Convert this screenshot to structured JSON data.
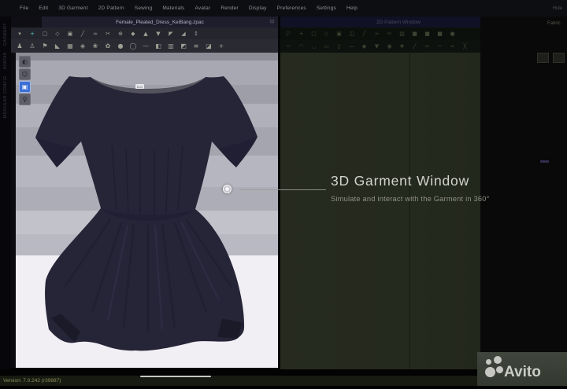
{
  "menubar": {
    "items": [
      {
        "name": "menu-file",
        "label": "File"
      },
      {
        "name": "menu-edit",
        "label": "Edit"
      },
      {
        "name": "menu-3d-garment",
        "label": "3D Garment"
      },
      {
        "name": "menu-2d-pattern",
        "label": "2D Pattern"
      },
      {
        "name": "menu-sewing",
        "label": "Sewing"
      },
      {
        "name": "menu-materials",
        "label": "Materials"
      },
      {
        "name": "menu-avatar",
        "label": "Avatar"
      },
      {
        "name": "menu-render",
        "label": "Render"
      },
      {
        "name": "menu-display",
        "label": "Display"
      },
      {
        "name": "menu-preferences",
        "label": "Preferences"
      },
      {
        "name": "menu-settings",
        "label": "Settings"
      },
      {
        "name": "menu-help",
        "label": "Help"
      }
    ],
    "right_label": "Hide"
  },
  "left_tabs": [
    "GARMENT",
    "AVATAR",
    "MODULAR CONFIG"
  ],
  "garment_window": {
    "title": "Female_Pleated_Dress_KeiBang.zpac",
    "popout_glyph": "⊡",
    "toolbar_row1": [
      {
        "name": "select-tool-icon",
        "glyph": "▾"
      },
      {
        "name": "add-point-icon",
        "glyph": "+"
      },
      {
        "name": "rectangle-tool-icon",
        "glyph": "▢"
      },
      {
        "name": "polygon-tool-icon",
        "glyph": "◇"
      },
      {
        "name": "paste-pattern-icon",
        "glyph": "▣"
      },
      {
        "name": "segment-sewing-icon",
        "glyph": "╱"
      },
      {
        "name": "free-sewing-icon",
        "glyph": "≈"
      },
      {
        "name": "edit-sewing-icon",
        "glyph": "✂"
      },
      {
        "name": "pin-tool-icon",
        "glyph": "⊕"
      },
      {
        "name": "fold-arrangement-icon",
        "glyph": "◆"
      },
      {
        "name": "arrange-front-icon",
        "glyph": "▲"
      },
      {
        "name": "arrange-back-icon",
        "glyph": "▼"
      },
      {
        "name": "flip-left-icon",
        "glyph": "◤"
      },
      {
        "name": "flip-right-icon",
        "glyph": "◢"
      },
      {
        "name": "move-garment-icon",
        "glyph": "↕"
      }
    ],
    "toolbar_row2": [
      {
        "name": "simulate-icon",
        "glyph": "♟"
      },
      {
        "name": "avatar-pose-icon",
        "glyph": "♙"
      },
      {
        "name": "avatar-tape-icon",
        "glyph": "⚑"
      },
      {
        "name": "avatar-measure-icon",
        "glyph": "◣"
      },
      {
        "name": "garment-fit-icon",
        "glyph": "▦"
      },
      {
        "name": "pressure-map-icon",
        "glyph": "◈"
      },
      {
        "name": "flower-trim-icon",
        "glyph": "❀"
      },
      {
        "name": "button-trim-icon",
        "glyph": "✿"
      },
      {
        "name": "buttonhole-icon",
        "glyph": "●"
      },
      {
        "name": "grading-icon",
        "glyph": "◯"
      },
      {
        "name": "seam-line-icon",
        "glyph": "—"
      },
      {
        "name": "texture-icon",
        "glyph": "◧"
      },
      {
        "name": "uv-map-icon",
        "glyph": "▥"
      },
      {
        "name": "layer-icon",
        "glyph": "◩"
      },
      {
        "name": "stack-icon",
        "glyph": "≡"
      },
      {
        "name": "mirror-icon",
        "glyph": "◪"
      },
      {
        "name": "zoom-tool-icon",
        "glyph": "+"
      }
    ],
    "side_tools": [
      {
        "name": "show-avatar-button",
        "glyph": "◐"
      },
      {
        "name": "show-skin-button",
        "glyph": "☺"
      },
      {
        "name": "show-garment-button",
        "glyph": "▣",
        "active": true
      },
      {
        "name": "show-mannequin-button",
        "glyph": "♀"
      }
    ],
    "label_tag": "CLO"
  },
  "pattern_window": {
    "title": "2D Pattern Window",
    "titlebar_icons": [
      {
        "name": "pattern-popout-icon",
        "glyph": "⊡"
      },
      {
        "name": "pattern-collapse-icon",
        "glyph": "⌄"
      }
    ],
    "toolbar_row1": [
      {
        "name": "transform-pattern-icon",
        "glyph": "◸"
      },
      {
        "name": "edit-pattern-icon",
        "glyph": "+"
      },
      {
        "name": "add-rectangle-icon",
        "glyph": "▢"
      },
      {
        "name": "add-polygon-icon",
        "glyph": "◇"
      },
      {
        "name": "dart-icon",
        "glyph": "▣"
      },
      {
        "name": "trace-icon",
        "glyph": "◫"
      },
      {
        "name": "sewing-2d-icon",
        "glyph": "╱"
      },
      {
        "name": "free-sewing-2d-icon",
        "glyph": "≈"
      },
      {
        "name": "scissors-icon",
        "glyph": "✂"
      },
      {
        "name": "hatch-icon",
        "glyph": "▨"
      },
      {
        "name": "swatch-1-icon",
        "glyph": "■"
      },
      {
        "name": "swatch-2-icon",
        "glyph": "■"
      },
      {
        "name": "swatch-3-icon",
        "glyph": "■"
      },
      {
        "name": "point-icon",
        "glyph": "●"
      }
    ],
    "toolbar_row2": [
      {
        "name": "unfold-icon",
        "glyph": "⌐"
      },
      {
        "name": "curve-up-icon",
        "glyph": "◠"
      },
      {
        "name": "curve-down-icon",
        "glyph": "◡"
      },
      {
        "name": "seam-allowance-icon",
        "glyph": "▭"
      },
      {
        "name": "notch-icon",
        "glyph": "▯"
      },
      {
        "name": "baseline-icon",
        "glyph": "—"
      },
      {
        "name": "grain-line-icon",
        "glyph": "◆"
      },
      {
        "name": "pleat-icon",
        "glyph": "▼"
      },
      {
        "name": "circle-pattern-icon",
        "glyph": "◉"
      },
      {
        "name": "symmetry-icon",
        "glyph": "❖"
      },
      {
        "name": "slash-icon",
        "glyph": "╱"
      },
      {
        "name": "parallel-icon",
        "glyph": "═"
      },
      {
        "name": "wave-icon",
        "glyph": "~"
      },
      {
        "name": "approx-icon",
        "glyph": "≃"
      },
      {
        "name": "cross-icon",
        "glyph": "╳"
      }
    ],
    "fabric_label": "Fabric"
  },
  "overlay": {
    "title": "3D Garment Window",
    "subtitle": "Simulate and interact with the Garment in 360°"
  },
  "statusbar": {
    "version_text": "Version: 7.0.242 (r39887)"
  },
  "watermark": {
    "brand": "Avito"
  },
  "colors": {
    "accent_blue": "#3d6fd6",
    "garment": "#262538",
    "garment_shadow": "#1a1930",
    "viewport_floor": "#f2eff4",
    "pattern_bg": "#262a1e",
    "watermark_bg": "#3c4138"
  }
}
